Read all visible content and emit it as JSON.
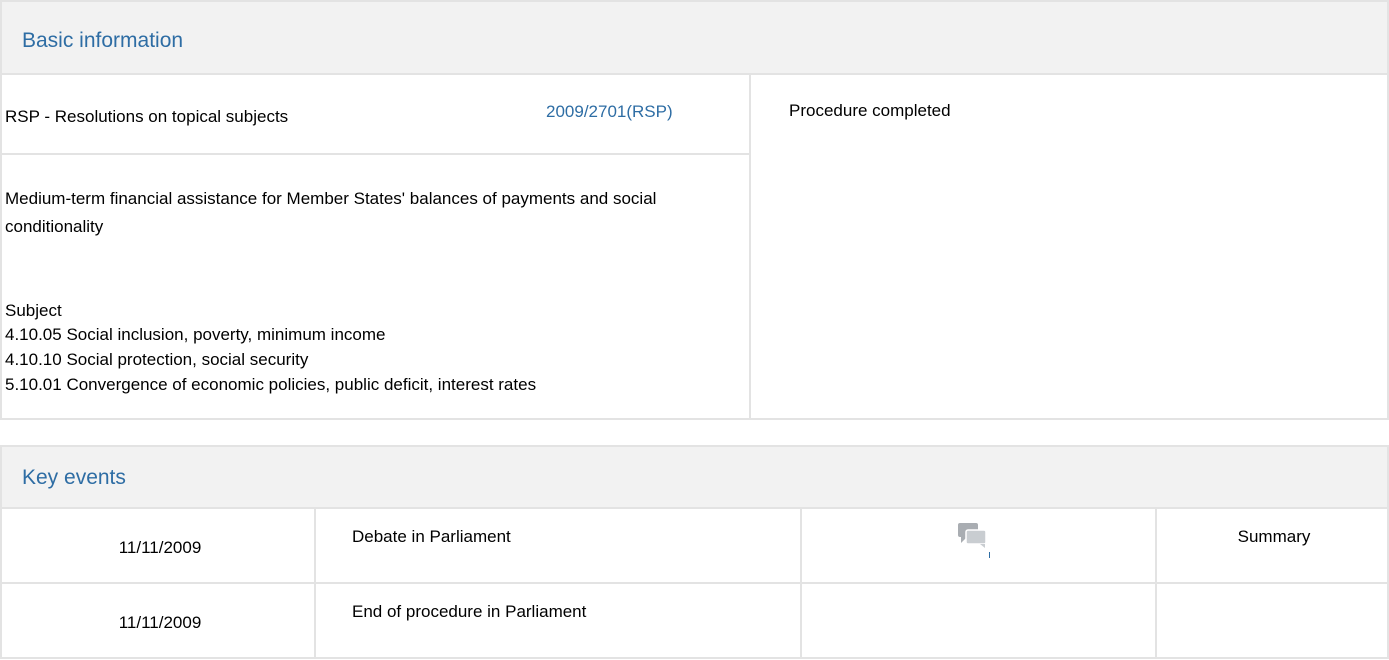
{
  "basic_information": {
    "header": "Basic information",
    "procedure_type": "RSP - Resolutions on topical subjects",
    "procedure_reference": "2009/2701(RSP)",
    "status": "Procedure completed",
    "title": "Medium-term financial assistance for Member States' balances of payments and social conditionality",
    "subject_label": "Subject",
    "subjects": [
      "4.10.05 Social inclusion, poverty, minimum income",
      "4.10.10 Social protection, social security",
      "5.10.01 Convergence of economic policies, public deficit, interest rates"
    ]
  },
  "key_events": {
    "header": "Key events",
    "rows": [
      {
        "date": "11/11/2009",
        "event": "Debate in Parliament",
        "icon": "debate-speech-bubbles-icon",
        "summary": "Summary"
      },
      {
        "date": "11/11/2009",
        "event": "End of procedure in Parliament",
        "summary": ""
      }
    ]
  },
  "colors": {
    "header_text": "#2e6da4",
    "header_bg": "#f2f2f2",
    "border": "#e3e3e3",
    "link": "#2e6da4"
  }
}
